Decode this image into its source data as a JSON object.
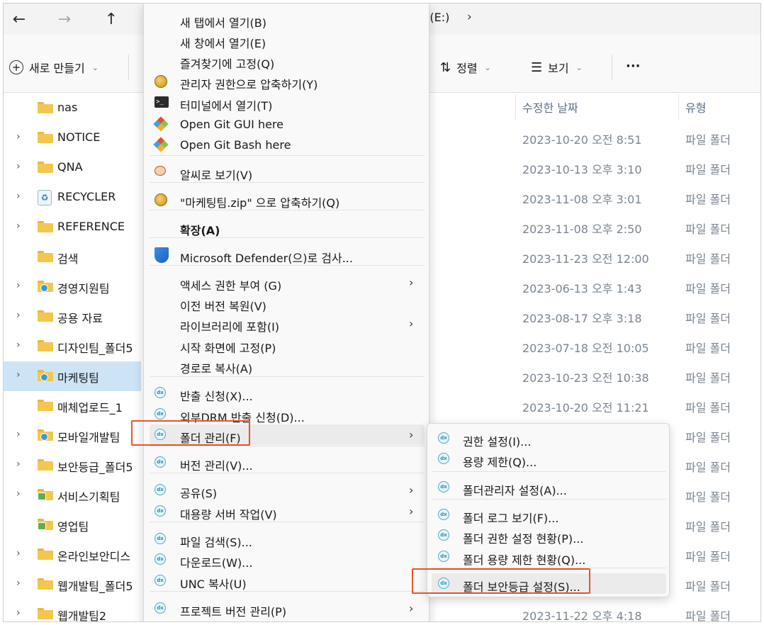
{
  "nav": {
    "back_icon": "←",
    "forward_icon": "→",
    "up_icon": "↑",
    "path_tail": ":(E:)",
    "path_chevron": "›"
  },
  "toolbar": {
    "new_label": "새로 만들기",
    "sort_label": "정렬",
    "view_label": "보기",
    "more_label": "···",
    "caret": "⌄"
  },
  "columns": {
    "date": "수정한 날짜",
    "type": "유형"
  },
  "files": [
    {
      "name": "nas",
      "date": "",
      "type": "",
      "expandable": false,
      "icon": "folder"
    },
    {
      "name": "NOTICE",
      "date": "2023-10-20 오전 8:51",
      "type": "파일 폴더",
      "expandable": true,
      "icon": "folder"
    },
    {
      "name": "QNA",
      "date": "2023-10-13 오후 3:10",
      "type": "파일 폴더",
      "expandable": true,
      "icon": "folder"
    },
    {
      "name": "RECYCLER",
      "date": "2023-11-08 오후 3:01",
      "type": "파일 폴더",
      "expandable": true,
      "icon": "recycle"
    },
    {
      "name": "REFERENCE",
      "date": "2023-11-08 오후 2:50",
      "type": "파일 폴더",
      "expandable": true,
      "icon": "folder"
    },
    {
      "name": "검색",
      "date": "2023-11-23 오전 12:00",
      "type": "파일 폴더",
      "expandable": false,
      "icon": "folder"
    },
    {
      "name": "경영지원팀",
      "date": "2023-06-13 오후 1:43",
      "type": "파일 폴더",
      "expandable": true,
      "icon": "folder-badge"
    },
    {
      "name": "공용 자료",
      "date": "2023-08-17 오후 3:18",
      "type": "파일 폴더",
      "expandable": true,
      "icon": "folder"
    },
    {
      "name": "디자인팀_폴더5",
      "date": "2023-07-18 오전 10:05",
      "type": "파일 폴더",
      "expandable": true,
      "icon": "folder"
    },
    {
      "name": "마케팅팀",
      "date": "2023-10-23 오전 10:38",
      "type": "파일 폴더",
      "expandable": true,
      "icon": "folder-badge",
      "selected": true
    },
    {
      "name": "매체업로드_1",
      "date": "2023-10-20 오전 11:21",
      "type": "파일 폴더",
      "expandable": false,
      "icon": "folder"
    },
    {
      "name": "모바일개발팀",
      "date": "",
      "type": "파일 폴더",
      "expandable": true,
      "icon": "folder-badge"
    },
    {
      "name": "보안등급_폴더5",
      "date": "",
      "type": "파일 폴더",
      "expandable": true,
      "icon": "folder"
    },
    {
      "name": "서비스기획팀",
      "date": "",
      "type": "파일 폴더",
      "expandable": true,
      "icon": "folder-share"
    },
    {
      "name": "영업팀",
      "date": "",
      "type": "파일 폴더",
      "expandable": false,
      "icon": "folder-share"
    },
    {
      "name": "온라인보안디스",
      "date": "",
      "type": "파일 폴더",
      "expandable": true,
      "icon": "folder"
    },
    {
      "name": "웹개발팀_폴더5",
      "date": "",
      "type": "파일 폴더",
      "expandable": true,
      "icon": "folder"
    },
    {
      "name": "웹개발팀2",
      "date": "2023-11-22 오후 4:18",
      "type": "파일 폴더",
      "expandable": true,
      "icon": "folder"
    }
  ],
  "menu": [
    {
      "label": "새 탭에서 열기(B)",
      "icon": "",
      "arrow": false
    },
    {
      "label": "새 창에서 열기(E)",
      "icon": "",
      "arrow": false
    },
    {
      "label": "즐겨찾기에 고정(Q)",
      "icon": "",
      "arrow": false
    },
    {
      "label": "관리자 권한으로 압축하기(Y)",
      "icon": "zip-admin-icon",
      "arrow": false
    },
    {
      "label": "터미널에서 열기(T)",
      "icon": "terminal-icon",
      "arrow": false
    },
    {
      "label": "Open Git GUI here",
      "icon": "git-icon",
      "arrow": false
    },
    {
      "label": "Open Git Bash here",
      "icon": "git-icon",
      "arrow": false
    },
    {
      "label": "알씨로 보기(V)",
      "icon": "alsee-icon",
      "arrow": false
    },
    {
      "label": "\"마케팅팀.zip\" 으로 압축하기(Q)",
      "icon": "zip-icon",
      "arrow": false
    },
    {
      "label": "확장(A)",
      "icon": "",
      "arrow": false,
      "bold": true
    },
    {
      "label": "Microsoft Defender(으)로 검사...",
      "icon": "defender-shield-icon",
      "arrow": false
    },
    {
      "label": "액세스 권한 부여 (G)",
      "icon": "",
      "arrow": true
    },
    {
      "label": "이전 버전 복원(V)",
      "icon": "",
      "arrow": false
    },
    {
      "label": "라이브러리에 포함(I)",
      "icon": "",
      "arrow": true
    },
    {
      "label": "시작 화면에 고정(P)",
      "icon": "",
      "arrow": false
    },
    {
      "label": "경로로 복사(A)",
      "icon": "",
      "arrow": false
    },
    {
      "label": "반출 신청(X)...",
      "icon": "drm-icon",
      "arrow": false
    },
    {
      "label": "외부DRM 반출 신청(D)...",
      "icon": "drm-icon",
      "arrow": false
    },
    {
      "label": "폴더 관리(F)",
      "icon": "drm-icon",
      "arrow": true,
      "highlight": true
    },
    {
      "label": "버전 관리(V)...",
      "icon": "drm-icon",
      "arrow": false
    },
    {
      "label": "공유(S)",
      "icon": "drm-icon",
      "arrow": true
    },
    {
      "label": "대용량 서버 작업(V)",
      "icon": "drm-icon",
      "arrow": true
    },
    {
      "label": "파일 검색(S)...",
      "icon": "drm-icon",
      "arrow": false
    },
    {
      "label": "다운로드(W)...",
      "icon": "drm-icon",
      "arrow": false
    },
    {
      "label": "UNC 복사(U)",
      "icon": "drm-icon",
      "arrow": false
    },
    {
      "label": "프로젝트 버전 관리(P)",
      "icon": "drm-icon",
      "arrow": true
    }
  ],
  "submenu": [
    {
      "label": "권한 설정(I)..."
    },
    {
      "label": "용량 제한(Q)..."
    },
    {
      "label": "폴더관리자 설정(A)..."
    },
    {
      "label": "폴더 로그 보기(F)..."
    },
    {
      "label": "폴더 권한 설정 현황(P)..."
    },
    {
      "label": "폴더 용량 제한 현황(Q)..."
    },
    {
      "label": "폴더 보안등급 설정(S)...",
      "highlight": true
    }
  ],
  "colors": {
    "highlight_outline": "#e4562a",
    "selection": "#cde4f7",
    "folder": "#f3c74f"
  }
}
